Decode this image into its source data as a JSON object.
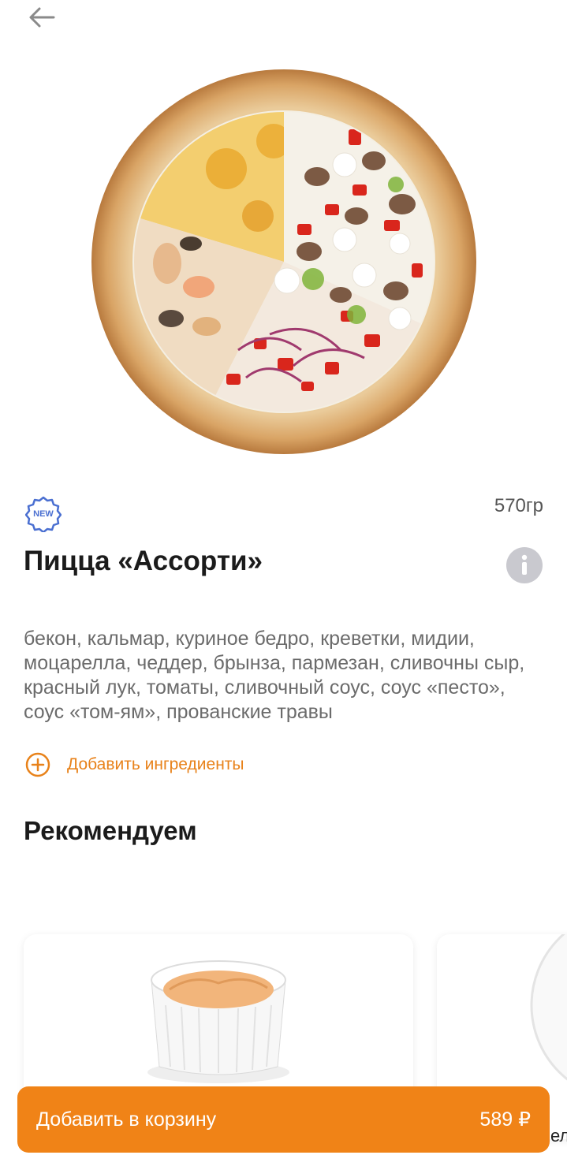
{
  "header": {
    "back_icon": "arrow-left-icon"
  },
  "product": {
    "image": "pizza-assorti-image",
    "badge": "NEW",
    "weight": "570гр",
    "title": "Пицца «Ассорти»",
    "info_icon": "info-icon",
    "description": "бекон, кальмар, куриное бедро, креветки, мидии, моцарелла, чеддер, брынза, пармезан, сливочны сыр, красный лук, томаты, сливочный соус, соус «песто», соус «том-ям», прованские травы",
    "add_ingredients_label": "Добавить ингредиенты",
    "add_icon": "plus-circle-icon"
  },
  "recommend": {
    "title": "Рекомендуем",
    "cards": [
      {
        "image": "sauce-ramekin-image"
      },
      {
        "image": "plate-image"
      }
    ]
  },
  "cart": {
    "label": "Добавить в корзину",
    "price": "589 ₽"
  },
  "edge_text": "ел",
  "colors": {
    "accent": "#f08317",
    "accent_text": "#e8821a",
    "badge_blue": "#4a6fd1",
    "info_grey": "#c9c9cf"
  }
}
